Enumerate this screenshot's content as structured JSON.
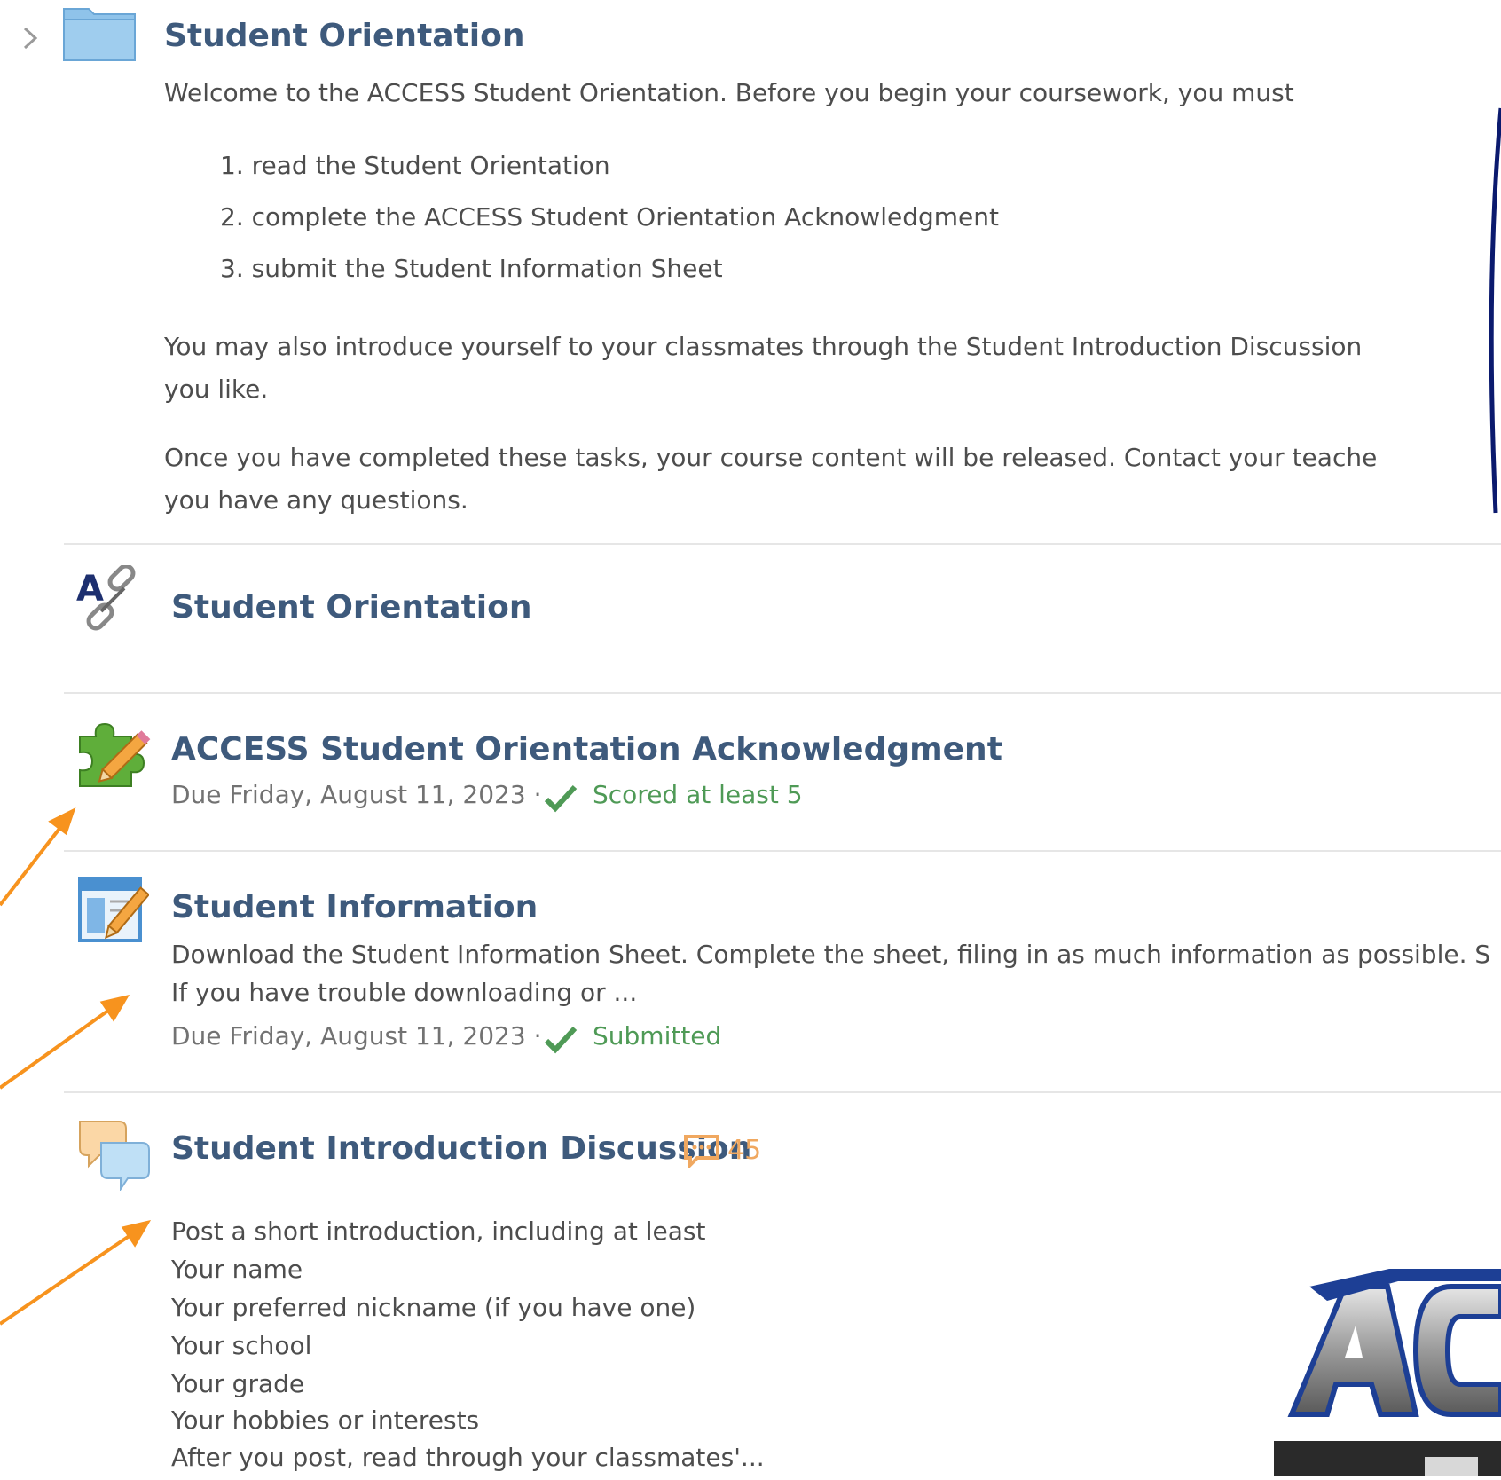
{
  "folder": {
    "title": "Student Orientation",
    "intro": "Welcome to the ACCESS Student Orientation. Before you begin your coursework, you must",
    "steps": [
      "1. read the Student Orientation",
      "2. complete the ACCESS Student Orientation Acknowledgment",
      "3. submit the Student Information  Sheet"
    ],
    "para1_line1": "You may also introduce yourself to your classmates through the Student Introduction Discussion",
    "para1_line2": "you like.",
    "para2_line1": "Once you have completed these tasks, your course content will be released. Contact your teache",
    "para2_line2": "you have any questions."
  },
  "items": {
    "link": {
      "title": "Student Orientation"
    },
    "acknowledgment": {
      "title": "ACCESS Student Orientation Acknowledgment",
      "due": "Due Friday, August 11, 2023 ·",
      "status": "Scored at least 5"
    },
    "info": {
      "title": "Student Information",
      "desc_line1": "Download the Student Information Sheet. Complete the sheet, filing in as much information as possible. S",
      "desc_line2": "If you have trouble downloading or ...",
      "due": "Due Friday, August 11, 2023 ·",
      "status": "Submitted"
    },
    "discussion": {
      "title": "Student Introduction Discussion",
      "comment_count": "45",
      "desc_lines": [
        "Post a short introduction, including at least",
        "Your name",
        "Your preferred nickname (if you have one)",
        "Your school",
        "Your grade",
        "Your hobbies or interests",
        "After you post, read through your classmates'..."
      ]
    }
  },
  "colors": {
    "title": "#3e5a7c",
    "status_green": "#4f9a56",
    "arrow_orange": "#f7931e",
    "folder_blue": "#8fc3ea"
  },
  "icons": {
    "chevron": "chevron-right-icon",
    "folder": "folder-icon",
    "link": "access-link-icon",
    "quiz": "quiz-puzzle-icon",
    "assignment": "assignment-icon",
    "discussion": "discussion-icon",
    "comment": "comment-icon",
    "check": "check-icon"
  }
}
